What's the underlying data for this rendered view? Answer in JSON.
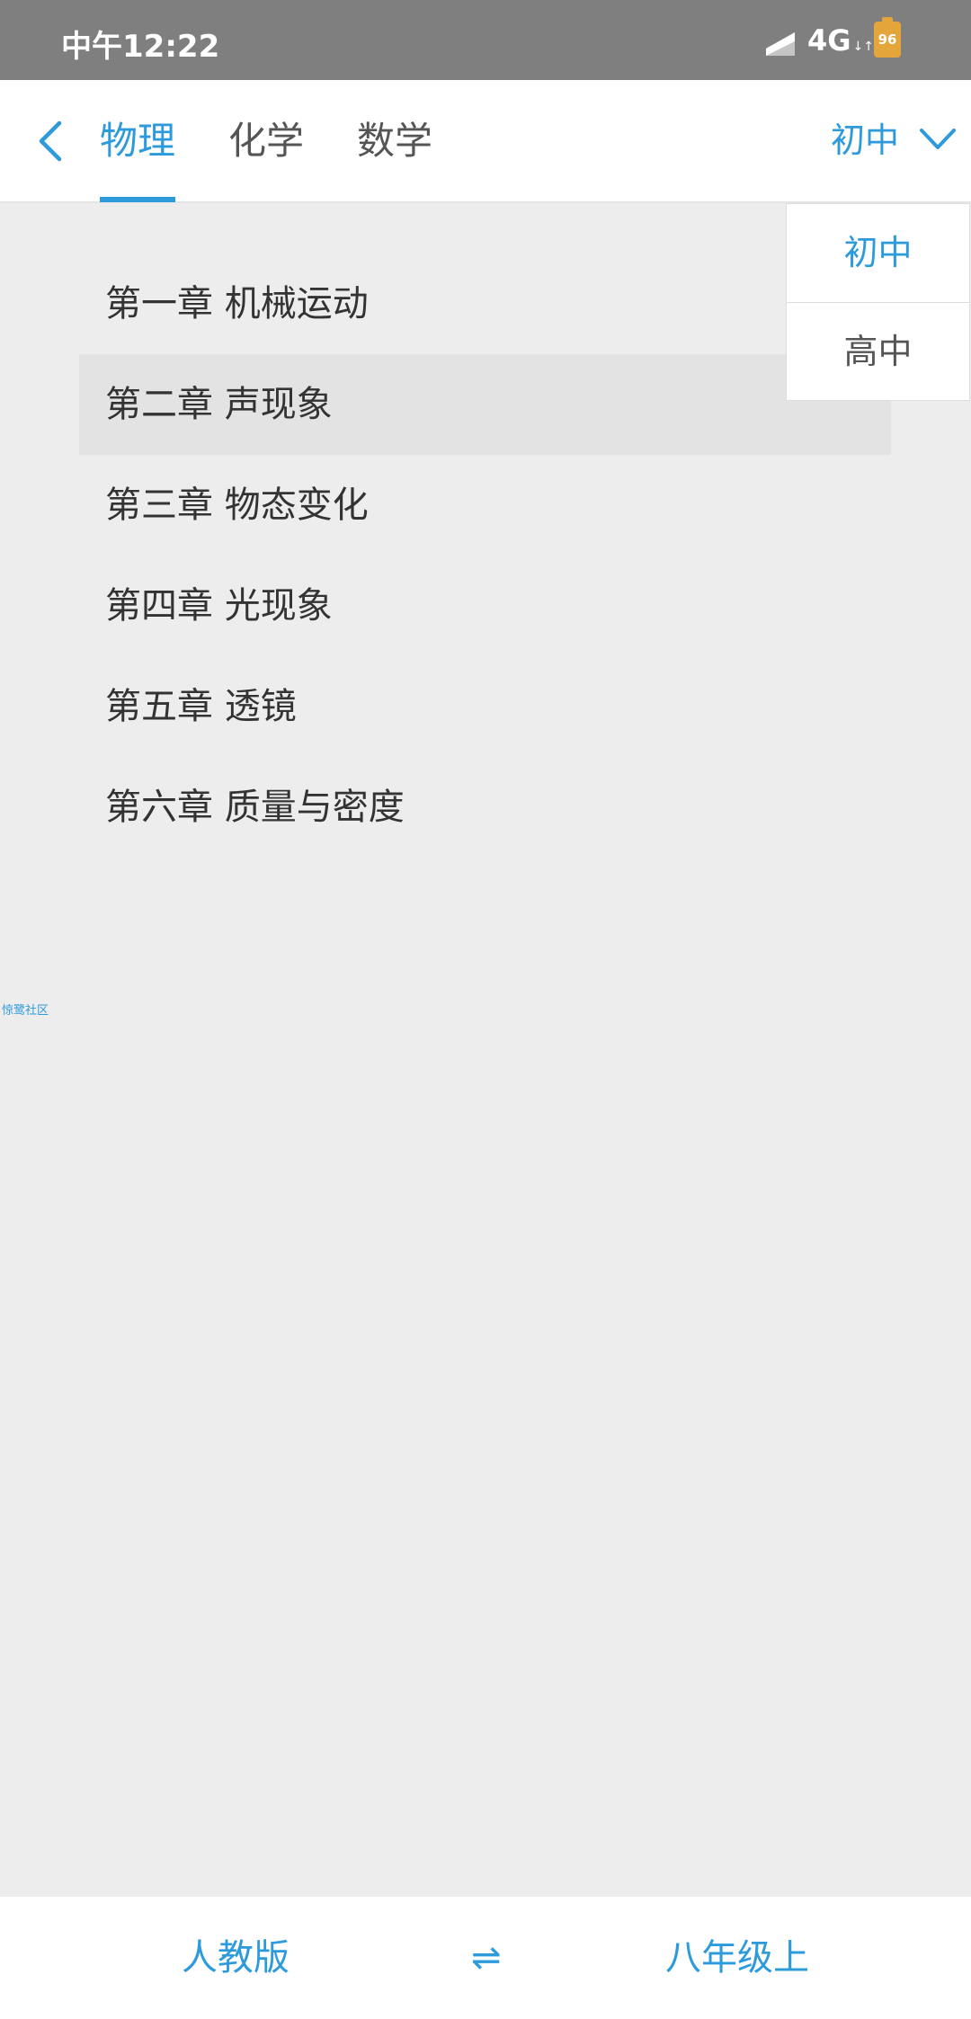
{
  "status_bar": {
    "time": "中午12:22",
    "network": "4G",
    "network_sub": "↓↑",
    "battery": "96"
  },
  "header": {
    "tabs": [
      {
        "label": "物理",
        "active": true
      },
      {
        "label": "化学",
        "active": false
      },
      {
        "label": "数学",
        "active": false
      }
    ],
    "level_selected": "初中"
  },
  "dropdown": {
    "options": [
      "初中",
      "高中"
    ],
    "selected": "初中"
  },
  "chapters": [
    "第一章 机械运动",
    "第二章 声现象",
    "第三章 物态变化",
    "第四章 光现象",
    "第五章 透镜",
    "第六章 质量与密度"
  ],
  "selected_chapter_index": 1,
  "watermark": "惊鹭社区",
  "bottom_bar": {
    "edition": "人教版",
    "swap_symbol": "⇌",
    "grade": "八年级上"
  },
  "colors": {
    "accent": "#2D9BDB",
    "status_bar": "#7F7F7F",
    "battery": "#E4A53A"
  },
  "icons": [
    "signal-icon",
    "back-icon",
    "chevron-down-icon",
    "swap-icon"
  ]
}
